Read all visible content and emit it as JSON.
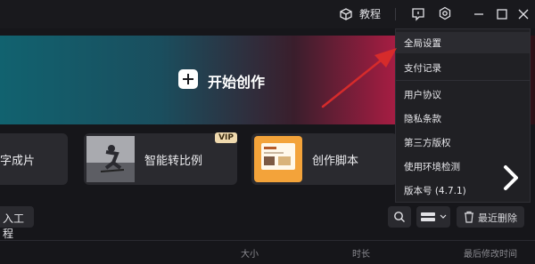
{
  "topbar": {
    "tutorial_label": "教程",
    "icons": [
      "tutorial-cube-icon",
      "chat-icon",
      "gear-icon",
      "minimize-icon",
      "maximize-icon",
      "close-icon"
    ]
  },
  "hero": {
    "label": "开始创作"
  },
  "cards": [
    {
      "label": "字成片"
    },
    {
      "label": "智能转比例",
      "badge": "VIP"
    },
    {
      "label": "创作脚本"
    }
  ],
  "toolbar": {
    "import_label": "入工程",
    "recent_delete_label": "最近删除"
  },
  "table_header": {
    "columns": [
      "大小",
      "时长",
      "最后修改时间"
    ]
  },
  "menu": {
    "items": [
      "全局设置",
      "支付记录",
      "用户协议",
      "隐私条款",
      "第三方版权",
      "使用环境检测",
      "版本号 (4.7.1)"
    ]
  },
  "colors": {
    "annotation_arrow": "#d62b2b",
    "vip_badge": "#efd9ae"
  }
}
